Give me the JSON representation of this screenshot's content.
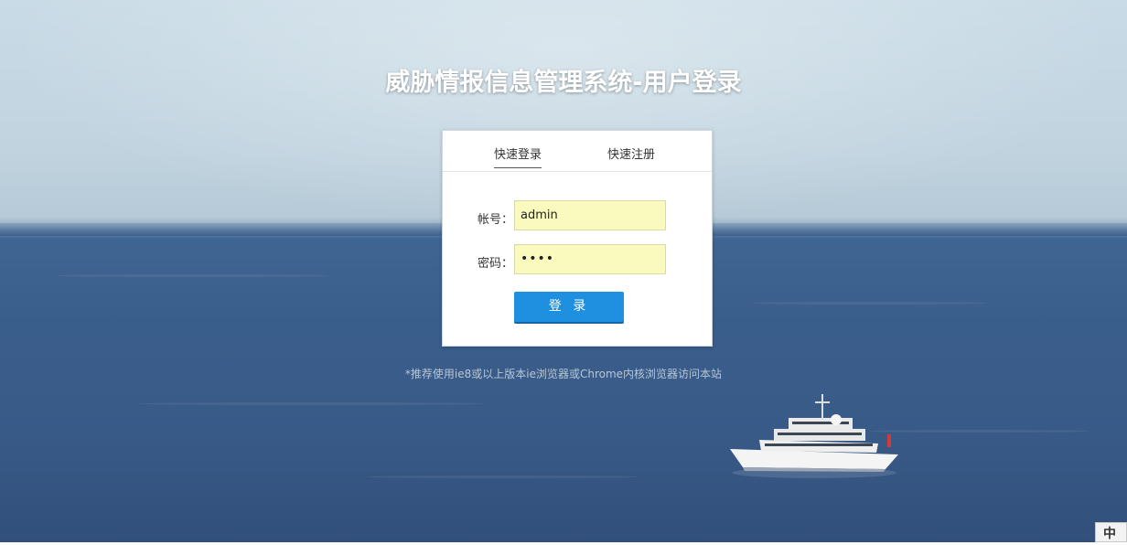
{
  "page": {
    "title": "威胁情报信息管理系统-用户登录"
  },
  "tabs": [
    {
      "label": "快速登录",
      "active": true
    },
    {
      "label": "快速注册",
      "active": false
    }
  ],
  "form": {
    "account_label": "帐号：",
    "account_value": "admin",
    "password_label": "密码：",
    "password_masked": "••••",
    "login_button": "登 录"
  },
  "tip": "*推荐使用ie8或以上版本ie浏览器或Chrome内核浏览器访问本站",
  "ime_indicator": "中",
  "colors": {
    "button": "#1f8fe0",
    "input_bg": "#fafabf",
    "sea": "#3a5e8c",
    "sky": "#c9dbe6"
  }
}
